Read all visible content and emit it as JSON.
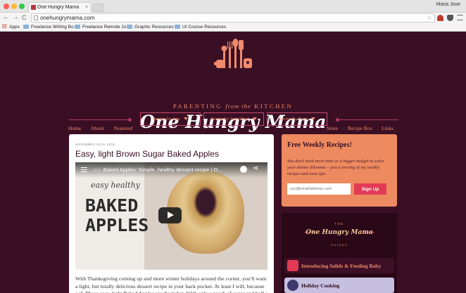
{
  "browser": {
    "tab_title": "One Hungry Mama",
    "tab_close": "×",
    "user_name": "Maria Jose",
    "url": "onehungrymama.com",
    "back": "←",
    "forward": "→",
    "reload": "C",
    "bookmarks": [
      {
        "label": "Apps"
      },
      {
        "label": "Freelance Writing Bo"
      },
      {
        "label": "Freelance Remote Jo"
      },
      {
        "label": "Graphic Resources"
      },
      {
        "label": "UI Course Resources"
      }
    ]
  },
  "site": {
    "tagline_parenting": "PARENTING",
    "tagline_from_the": "from the",
    "tagline_kitchen": "KITCHEN",
    "title": "One Hungry Mama",
    "nav_left": [
      "Home",
      "About",
      "Featured"
    ],
    "nav_right": [
      "Store",
      "Recipe Box",
      "Links"
    ],
    "filters": [
      "Recipe by Age",
      "Recipe by Ingredient",
      "Recipe by Type"
    ]
  },
  "post": {
    "date": "NOVEMBER 24TH, 2015",
    "title": "Easy, light Brown Sugar Baked Apples",
    "video": {
      "count": "6/10",
      "title": "Baked Apples: Simple, healthy dessert recipe | O...",
      "text_small": "easy healthy",
      "text_big_1": "BAKED",
      "text_big_2": "APPLES"
    },
    "body": "With Thanksgiving coming up and more winter holidays around the corner, you'll want a light, but totally delicious dessert recipe in your back pocket. At least I will, because oof. These easy, light Baked Apples are the ticket. With only a touch of sugar and half a pat of"
  },
  "sidebar": {
    "signup_title": "Free Weekly Recipes!",
    "signup_text": "You don't need more time or a bigger budget to solve your dinner dilemma – just a serving of my weekly recipes and easy tips.",
    "email_placeholder": "you@emailaddress.com",
    "signup_button": "Sign Up",
    "guide_the": "THE",
    "guide_title": "One Hungry Mama",
    "guide_sub": "GUIDES",
    "guide_items": [
      "Introducing Solids & Feeding Baby",
      "Holiday Cooking"
    ]
  },
  "colors": {
    "background": "#3a0f24",
    "accent": "#f08a6c",
    "signup_card": "#ee8a5f",
    "button": "#e23a55"
  }
}
